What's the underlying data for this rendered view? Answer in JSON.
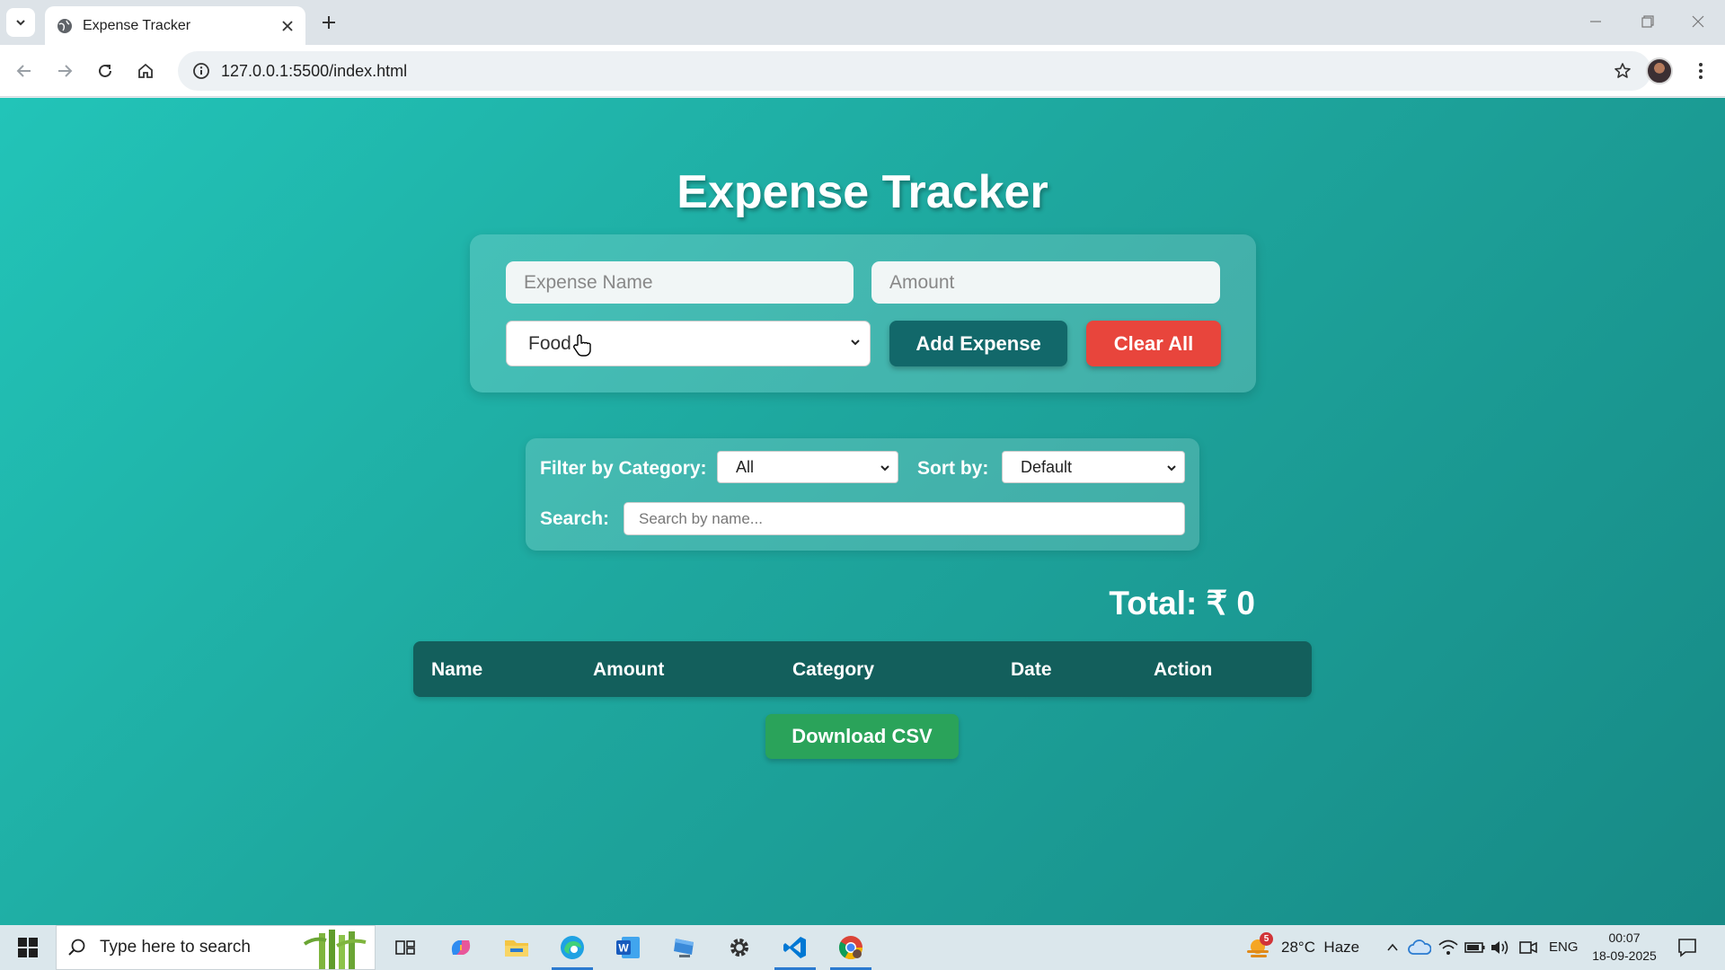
{
  "browser": {
    "tab_title": "Expense Tracker",
    "url": "127.0.0.1:5500/index.html"
  },
  "app": {
    "title": "Expense Tracker",
    "form": {
      "name_placeholder": "Expense Name",
      "amount_placeholder": "Amount",
      "category_selected": "Food",
      "add_button": "Add Expense",
      "clear_button": "Clear All"
    },
    "filters": {
      "category_label": "Filter by Category:",
      "category_selected": "All",
      "sort_label": "Sort by:",
      "sort_selected": "Default",
      "search_label": "Search:",
      "search_placeholder": "Search by name..."
    },
    "total": "Total: ₹ 0",
    "table": {
      "headers": [
        "Name",
        "Amount",
        "Category",
        "Date",
        "Action"
      ]
    },
    "download_button": "Download CSV"
  },
  "taskbar": {
    "search_placeholder": "Type here to search",
    "weather_badge": "5",
    "weather": "28°C  Haze",
    "language": "ENG",
    "time": "00:07",
    "date": "18-09-2025",
    "icons": [
      "task-view-icon",
      "copilot-icon",
      "file-explorer-icon",
      "edge-icon",
      "word-icon",
      "remote-desktop-icon",
      "settings-icon",
      "vscode-icon",
      "chrome-icon"
    ]
  },
  "colors": {
    "page_gradient_start": "#22c4b8",
    "page_gradient_end": "#178a86",
    "add_button": "#12686a",
    "clear_button": "#e8453c",
    "table_header": "#135f5c",
    "csv_button": "#2aa35a"
  }
}
